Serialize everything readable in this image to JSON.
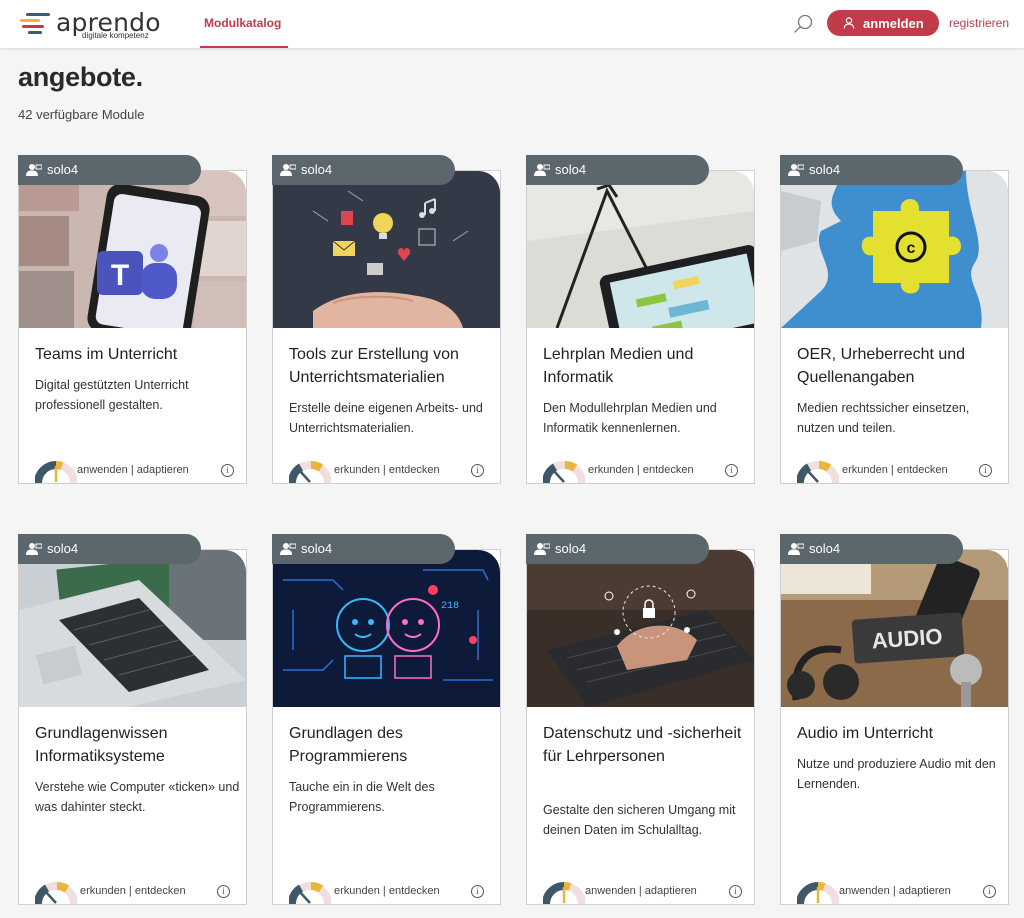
{
  "header": {
    "logo": {
      "name": "aprendo",
      "tagline": "digitale kompetenz"
    },
    "nav_tab": "Modulkatalog",
    "login_label": "anmelden",
    "register_label": "registrieren"
  },
  "page": {
    "title": "angebote.",
    "count_text": "42 verfügbare Module"
  },
  "colors": {
    "accent": "#c23b4a",
    "tab": "#5c666d"
  },
  "cards": [
    {
      "tag": "solo4",
      "title": "Teams im Unterricht",
      "description": "Digital gestützten Unterricht professionell gestalten.",
      "level": "anwenden | adaptieren",
      "gauge_color": "#e9b53c",
      "icon": "user-icon"
    },
    {
      "tag": "solo4",
      "title": "Tools zur Erstellung von Unterrichtsmaterialien",
      "description": "Erstelle deine eigenen Arbeits- und Unterrichtsmaterialien.",
      "level": "erkunden | entdecken",
      "gauge_color": "#4a5f6e",
      "icon": "user-icon"
    },
    {
      "tag": "solo4",
      "title": "Lehrplan Medien und Informatik",
      "description": "Den Modullehrplan Medien und Informatik kennenlernen.",
      "level": "erkunden | entdecken",
      "gauge_color": "#4a5f6e",
      "icon": "user-icon"
    },
    {
      "tag": "solo4",
      "title": "OER, Urheberrecht und Quellenangaben",
      "description": "Medien rechtssicher einsetzen, nutzen und teilen.",
      "level": "erkunden | entdecken",
      "gauge_color": "#4a5f6e",
      "icon": "user-icon"
    },
    {
      "tag": "solo4",
      "title": "Grundlagenwissen Informatiksysteme",
      "description": "Verstehe wie Computer «ticken» und was dahinter steckt.",
      "level": "erkunden | entdecken",
      "gauge_color": "#4a5f6e",
      "icon": "user-icon"
    },
    {
      "tag": "solo4",
      "title": "Grundlagen des Programmierens",
      "description": "Tauche ein in die Welt des Programmierens.",
      "level": "erkunden | entdecken",
      "gauge_color": "#4a5f6e",
      "icon": "user-icon"
    },
    {
      "tag": "solo4",
      "title": "Datenschutz und -sicherheit für Lehrpersonen",
      "description": "Gestalte den sicheren Umgang mit deinen Daten im Schulalltag.",
      "level": "anwenden | adaptieren",
      "gauge_color": "#e9b53c",
      "icon": "user-icon"
    },
    {
      "tag": "solo4",
      "title": "Audio im Unterricht",
      "description": "Nutze und produziere Audio mit den Lernenden.",
      "level": "anwenden | adaptieren",
      "gauge_color": "#e9b53c",
      "icon": "user-icon"
    }
  ]
}
